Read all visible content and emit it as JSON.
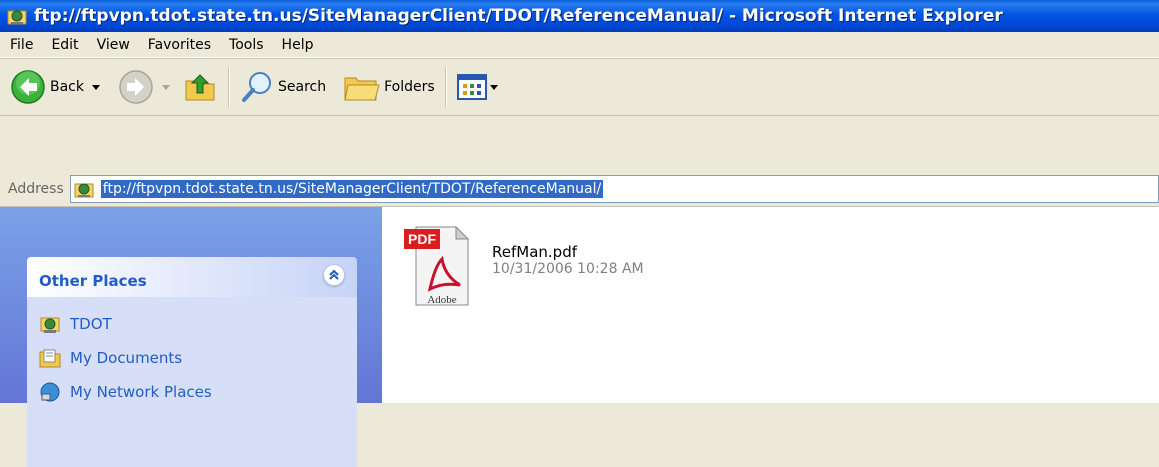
{
  "window": {
    "title": "ftp://ftpvpn.tdot.state.tn.us/SiteManagerClient/TDOT/ReferenceManual/ - Microsoft Internet Explorer"
  },
  "menu": [
    {
      "label": "File"
    },
    {
      "label": "Edit"
    },
    {
      "label": "View"
    },
    {
      "label": "Favorites"
    },
    {
      "label": "Tools"
    },
    {
      "label": "Help"
    }
  ],
  "toolbar": {
    "back_label": "Back",
    "search_label": "Search",
    "folders_label": "Folders"
  },
  "address": {
    "label": "Address",
    "value": "ftp://ftpvpn.tdot.state.tn.us/SiteManagerClient/TDOT/ReferenceManual/"
  },
  "taskpane": {
    "other_places": {
      "title": "Other Places",
      "items": [
        {
          "label": "TDOT",
          "icon": "ftp-folder-icon"
        },
        {
          "label": "My Documents",
          "icon": "my-documents-icon"
        },
        {
          "label": "My Network Places",
          "icon": "network-places-icon"
        }
      ]
    }
  },
  "files": [
    {
      "name": "RefMan.pdf",
      "date": "10/31/2006 10:28 AM",
      "icon": "pdf-file-icon"
    }
  ],
  "colors": {
    "titlebar": "#0055e5",
    "taskpane_bg": "#6f8fe0",
    "link_blue": "#215dc6",
    "selection": "#316ac5"
  }
}
